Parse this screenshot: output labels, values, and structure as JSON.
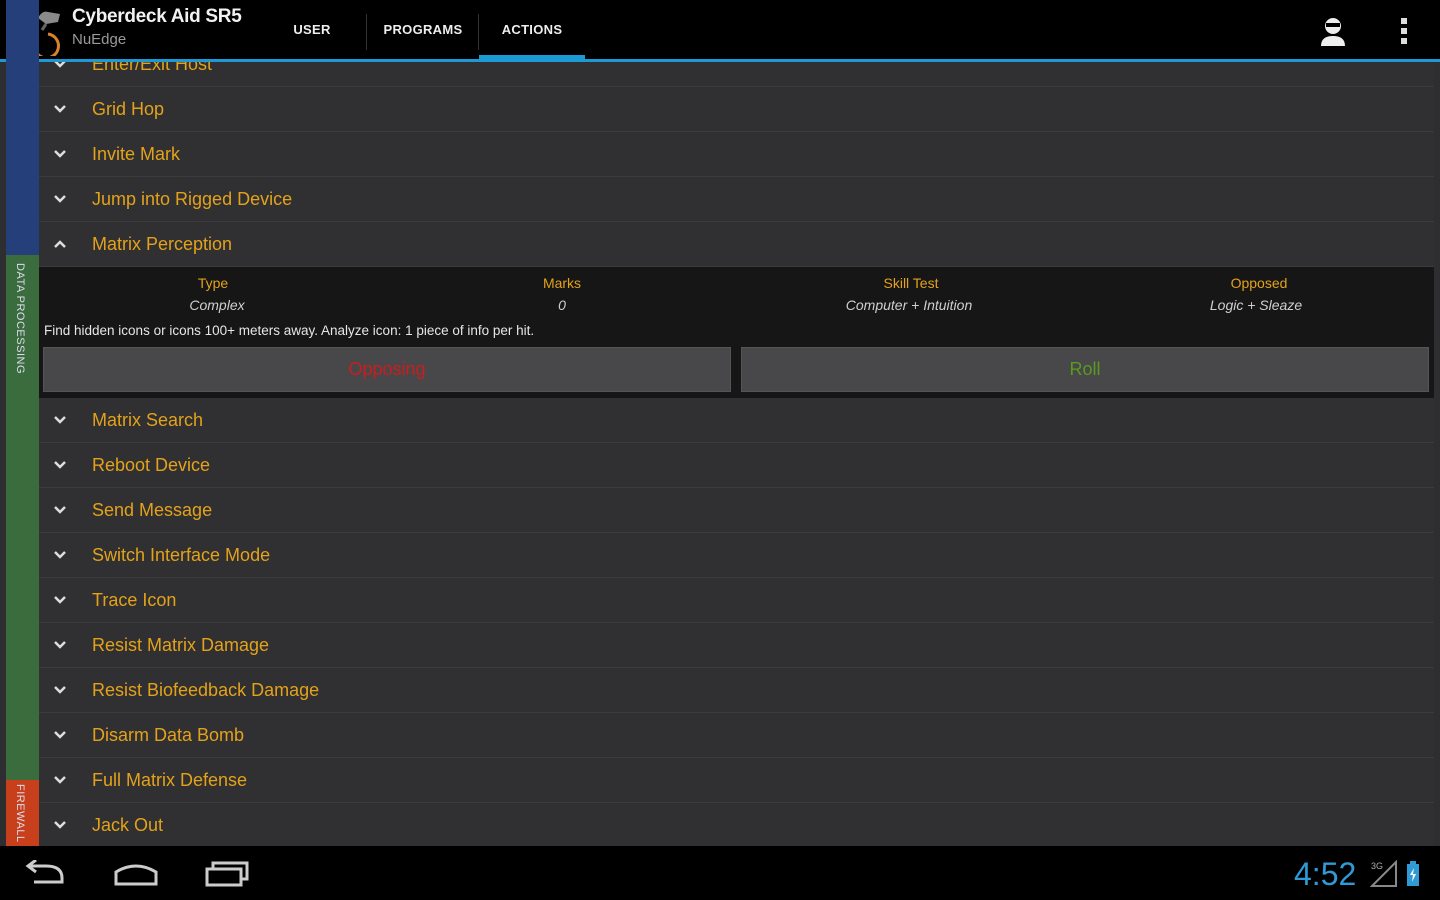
{
  "app": {
    "title": "Cyberdeck Aid SR5",
    "subtitle": "NuEdge"
  },
  "tabs": [
    {
      "label": "USER",
      "selected": false
    },
    {
      "label": "PROGRAMS",
      "selected": false
    },
    {
      "label": "ACTIONS",
      "selected": true
    }
  ],
  "side_strip": {
    "labels": [
      "DATA PROCESSING",
      "FIREWALL"
    ],
    "colors": {
      "top": "#243f7a",
      "middle": "#3a6c3d",
      "bottom": "#c7401b"
    }
  },
  "actions_before": [
    "Enter/Exit Host",
    "Grid Hop",
    "Invite Mark",
    "Jump into Rigged Device",
    "Matrix Perception"
  ],
  "expanded_action": {
    "name": "Matrix Perception",
    "columns": [
      {
        "header": "Type",
        "value": "Complex"
      },
      {
        "header": "Marks",
        "value": "0"
      },
      {
        "header": "Skill Test",
        "value": "Computer + Intuition"
      },
      {
        "header": "Opposed",
        "value": "Logic + Sleaze"
      }
    ],
    "description": "Find hidden icons or icons 100+ meters away. Analyze icon: 1 piece of info per hit.",
    "buttons": {
      "opposing": "Opposing",
      "roll": "Roll"
    }
  },
  "actions_after": [
    "Matrix Search",
    "Reboot Device",
    "Send Message",
    "Switch Interface Mode",
    "Trace Icon",
    "Resist Matrix Damage",
    "Resist Biofeedback Damage",
    "Disarm Data Bomb",
    "Full Matrix Defense",
    "Jack Out"
  ],
  "status_bar": {
    "time": "4:52",
    "network": "3G"
  },
  "colors": {
    "accent": "#1c9ad6",
    "label": "#e3a21a",
    "opposing": "#c81e1e",
    "roll": "#5a9a1e"
  },
  "icons": [
    "app-logo-icon",
    "user-icon",
    "overflow-menu-icon",
    "chevron-down-icon",
    "chevron-up-icon",
    "back-icon",
    "home-icon",
    "recent-apps-icon",
    "signal-icon",
    "battery-icon"
  ]
}
